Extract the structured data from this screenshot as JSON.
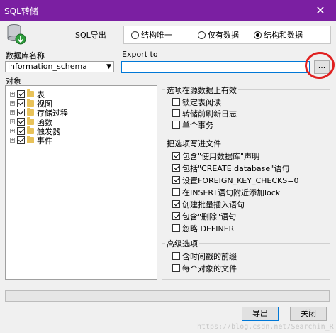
{
  "window": {
    "title": "SQL转储",
    "close_glyph": "✕"
  },
  "export_type": {
    "label": "SQL导出",
    "options": [
      {
        "label": "结构唯一",
        "selected": false
      },
      {
        "label": "仅有数据",
        "selected": false
      },
      {
        "label": "结构和数据",
        "selected": true
      }
    ]
  },
  "database": {
    "label": "数据库名称",
    "value": "information_schema"
  },
  "export_to": {
    "label": "Export to",
    "value": "",
    "browse_label": "..."
  },
  "objects": {
    "label": "对象",
    "items": [
      {
        "label": "表",
        "checked": true
      },
      {
        "label": "视图",
        "checked": true
      },
      {
        "label": "存储过程",
        "checked": true
      },
      {
        "label": "函数",
        "checked": true
      },
      {
        "label": "触发器",
        "checked": true
      },
      {
        "label": "事件",
        "checked": true
      }
    ]
  },
  "source_options": {
    "title": "选项在源数据上有效",
    "items": [
      {
        "label": "锁定表阅读",
        "checked": false
      },
      {
        "label": "转储前刷新日志",
        "checked": false
      },
      {
        "label": "单个事务",
        "checked": false
      }
    ]
  },
  "write_options": {
    "title": "把选项写进文件",
    "items": [
      {
        "label": "包含\"使用数据库\"声明",
        "checked": true
      },
      {
        "label": "包括\"CREATE database\"语句",
        "checked": true
      },
      {
        "label": "设置FOREIGN_KEY_CHECKS=0",
        "checked": true
      },
      {
        "label": "在INSERT语句附近添加lock",
        "checked": false
      },
      {
        "label": "创建批量插入语句",
        "checked": true
      },
      {
        "label": "包含\"删除\"语句",
        "checked": true
      },
      {
        "label": "忽略 DEFINER",
        "checked": false
      }
    ]
  },
  "advanced": {
    "title": "高级选项",
    "items": [
      {
        "label": "含时间戳的前缀",
        "checked": false
      },
      {
        "label": "每个对象的文件",
        "checked": false
      }
    ]
  },
  "progress": {
    "value": 0
  },
  "buttons": {
    "export": "导出",
    "close": "关闭"
  },
  "watermark": "https://blog.csdn.net/Searchin_R",
  "colors": {
    "titlebar": "#7b1fa2",
    "annotation": "#e02020",
    "focus": "#0078d7"
  }
}
